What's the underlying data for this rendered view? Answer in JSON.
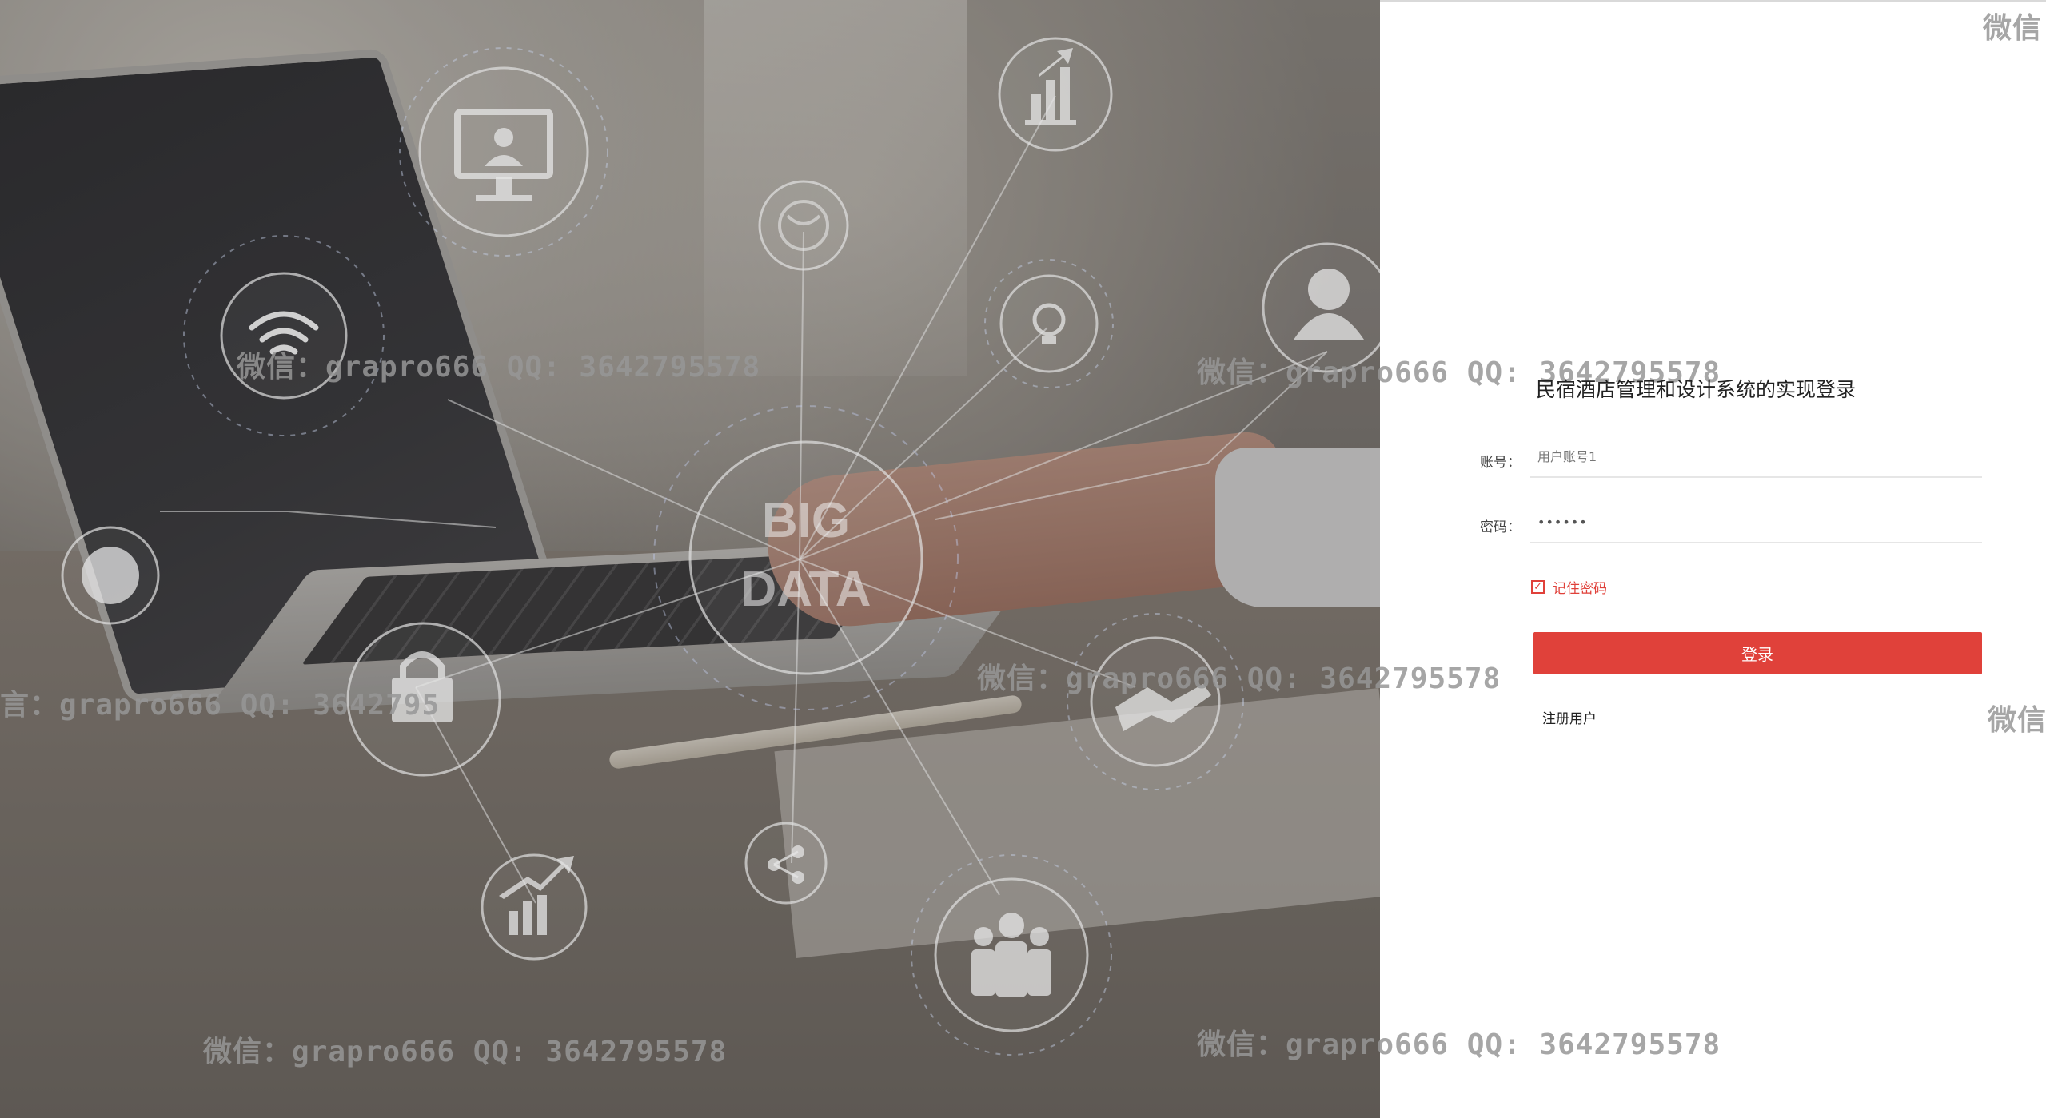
{
  "hero": {
    "badge_line1": "BIG",
    "badge_line2": "DATA",
    "icons": [
      "monitor-user-icon",
      "bar-chart-icon",
      "globe-refresh-icon",
      "wifi-icon",
      "lightbulb-icon",
      "user-icon",
      "globe-icon",
      "lock-icon",
      "handshake-icon",
      "share-icon",
      "trend-chart-icon",
      "team-icon"
    ]
  },
  "watermark": {
    "text": "微信：grapro666 QQ: 3642795578",
    "fragment_top": "微信",
    "fragment_mid": "微信",
    "fragment_left": "言：grapro666 QQ: 3642795"
  },
  "login": {
    "title": "民宿酒店管理和设计系统的实现登录",
    "account_label": "账号：",
    "account_placeholder": "用户账号1",
    "password_label": "密码：",
    "password_value": "••••••",
    "remember_label": "记住密码",
    "remember_checked": true,
    "submit_label": "登录",
    "register_label": "注册用户"
  },
  "colors": {
    "accent": "#e0413a",
    "text": "#222222",
    "input_border": "#e6e6e6"
  }
}
